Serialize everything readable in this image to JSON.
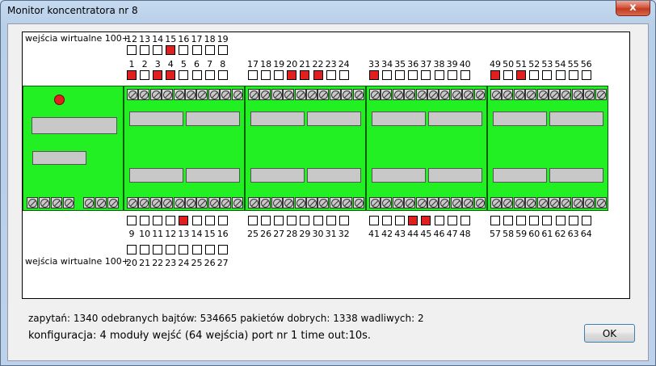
{
  "window": {
    "title": "Monitor koncentratora nr 8",
    "close_glyph": "x"
  },
  "virtual_label": "wejścia wirtualne 100+",
  "top_virtual": {
    "numbers": [
      "12",
      "13",
      "14",
      "15",
      "16",
      "17",
      "18",
      "19"
    ],
    "states": [
      0,
      0,
      0,
      1,
      0,
      0,
      0,
      0
    ]
  },
  "bottom_virtual": {
    "numbers": [
      "20",
      "21",
      "22",
      "23",
      "24",
      "25",
      "26",
      "27"
    ],
    "states": [
      0,
      0,
      0,
      0,
      0,
      0,
      0,
      0
    ]
  },
  "top_groups": [
    {
      "numbers": [
        "1",
        "2",
        "3",
        "4",
        "5",
        "6",
        "7",
        "8"
      ],
      "states": [
        1,
        0,
        1,
        1,
        0,
        0,
        0,
        0
      ]
    },
    {
      "numbers": [
        "17",
        "18",
        "19",
        "20",
        "21",
        "22",
        "23",
        "24"
      ],
      "states": [
        0,
        0,
        0,
        1,
        1,
        1,
        0,
        0
      ]
    },
    {
      "numbers": [
        "33",
        "34",
        "35",
        "36",
        "37",
        "38",
        "39",
        "40"
      ],
      "states": [
        1,
        0,
        0,
        0,
        0,
        0,
        0,
        0
      ]
    },
    {
      "numbers": [
        "49",
        "50",
        "51",
        "52",
        "53",
        "54",
        "55",
        "56"
      ],
      "states": [
        1,
        0,
        1,
        0,
        0,
        0,
        0,
        0
      ]
    }
  ],
  "bottom_groups": [
    {
      "numbers": [
        "9",
        "10",
        "11",
        "12",
        "13",
        "14",
        "15",
        "16"
      ],
      "states": [
        0,
        0,
        0,
        0,
        1,
        0,
        0,
        0
      ]
    },
    {
      "numbers": [
        "25",
        "26",
        "27",
        "28",
        "29",
        "30",
        "31",
        "32"
      ],
      "states": [
        0,
        0,
        0,
        0,
        0,
        0,
        0,
        0
      ]
    },
    {
      "numbers": [
        "41",
        "42",
        "43",
        "44",
        "45",
        "46",
        "47",
        "48"
      ],
      "states": [
        0,
        0,
        0,
        1,
        1,
        0,
        0,
        0
      ]
    },
    {
      "numbers": [
        "57",
        "58",
        "59",
        "60",
        "61",
        "62",
        "63",
        "64"
      ],
      "states": [
        0,
        0,
        0,
        0,
        0,
        0,
        0,
        0
      ]
    }
  ],
  "status": {
    "line1": "zapytań: 1340  odebranych bajtów: 534665  pakietów dobrych: 1338 wadliwych: 2",
    "line2": "konfiguracja: 4 moduły wejść (64 wejścia)    port nr 1    time out:10s."
  },
  "ok_label": "OK",
  "colors": {
    "active": "#e01f1f",
    "module": "#22f022",
    "led": "#e01f1f"
  },
  "icons": {
    "screw": "screw-terminal-icon",
    "led": "led-indicator-icon"
  }
}
